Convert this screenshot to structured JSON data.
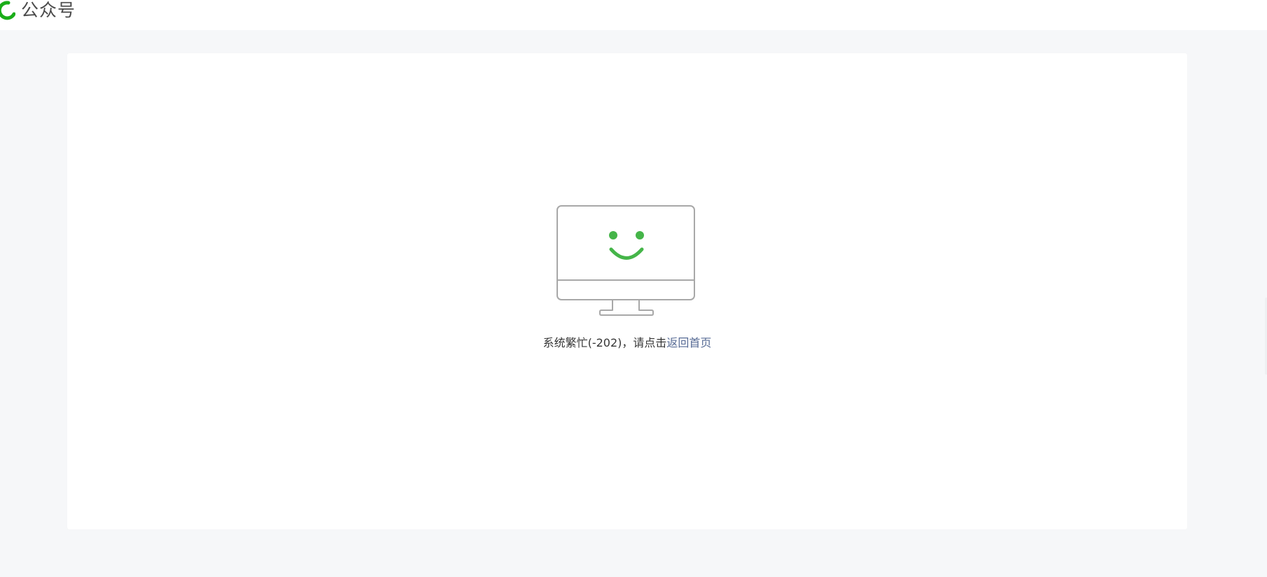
{
  "header": {
    "brand_text": "公众号",
    "logo_icon": "wechat-official-account-logo-icon"
  },
  "error": {
    "illustration_icon": "smiling-monitor-icon",
    "message": "系统繁忙(-202)，请点击",
    "link_label": "返回首页"
  },
  "colors": {
    "accent_green": "#45b549",
    "link_blue": "#576b95",
    "page_bg": "#f6f7f9",
    "outline_gray": "#a8a8a8"
  }
}
